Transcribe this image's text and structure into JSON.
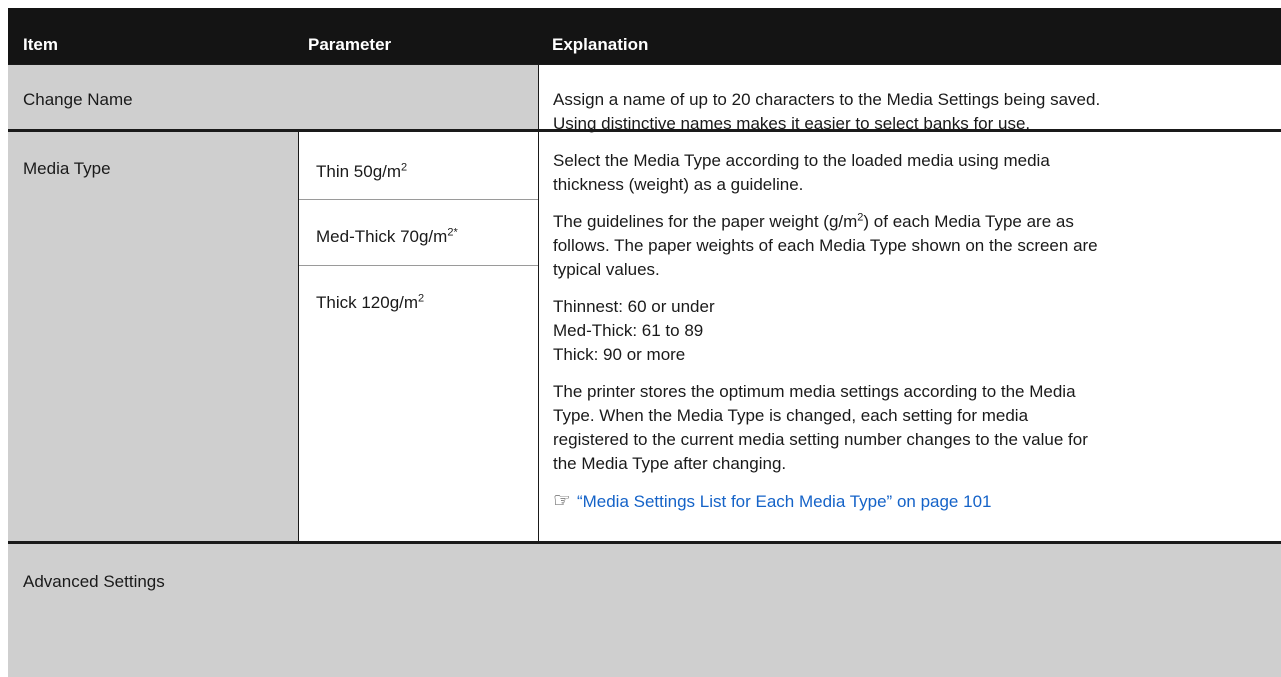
{
  "table": {
    "headers": {
      "item": "Item",
      "parameter": "Parameter",
      "explanation": "Explanation"
    },
    "change_name": {
      "item": "Change Name",
      "explanation_line1": "Assign a name of up to 20 characters to the Media Settings being saved.",
      "explanation_line2": "Using distinctive names makes it easier to select banks for use."
    },
    "media_type": {
      "item": "Media Type",
      "params": [
        {
          "label": "Thin 50g/m",
          "sup": "2"
        },
        {
          "label": "Med-Thick 70g/m",
          "sup": "2*"
        },
        {
          "label": "Thick 120g/m",
          "sup": "2"
        }
      ],
      "para1_line1": "Select the Media Type according to the loaded media using media",
      "para1_line2": "thickness (weight) as a guideline.",
      "para2_line1_a": "The guidelines for the paper weight (g/m",
      "para2_line1_sup": "2",
      "para2_line1_b": ") of each Media Type are as",
      "para2_line2": "follows. The paper weights of each Media Type shown on the screen are",
      "para2_line3": "typical values.",
      "list": [
        "Thinnest: 60 or under",
        "Med-Thick: 61 to 89",
        "Thick: 90 or more"
      ],
      "para3_lines": [
        "The printer stores the optimum media settings according to the Media",
        "Type. When the Media Type is changed, each setting for media",
        "registered to the current media setting number changes to the value for",
        "the Media Type after changing."
      ],
      "link_text": "“Media Settings List for Each Media Type” on page 101"
    },
    "advanced": {
      "item": "Advanced Settings"
    },
    "colors": {
      "header_bg": "#141414",
      "group_bg": "#cfcfcf",
      "link": "#1563c8"
    }
  }
}
